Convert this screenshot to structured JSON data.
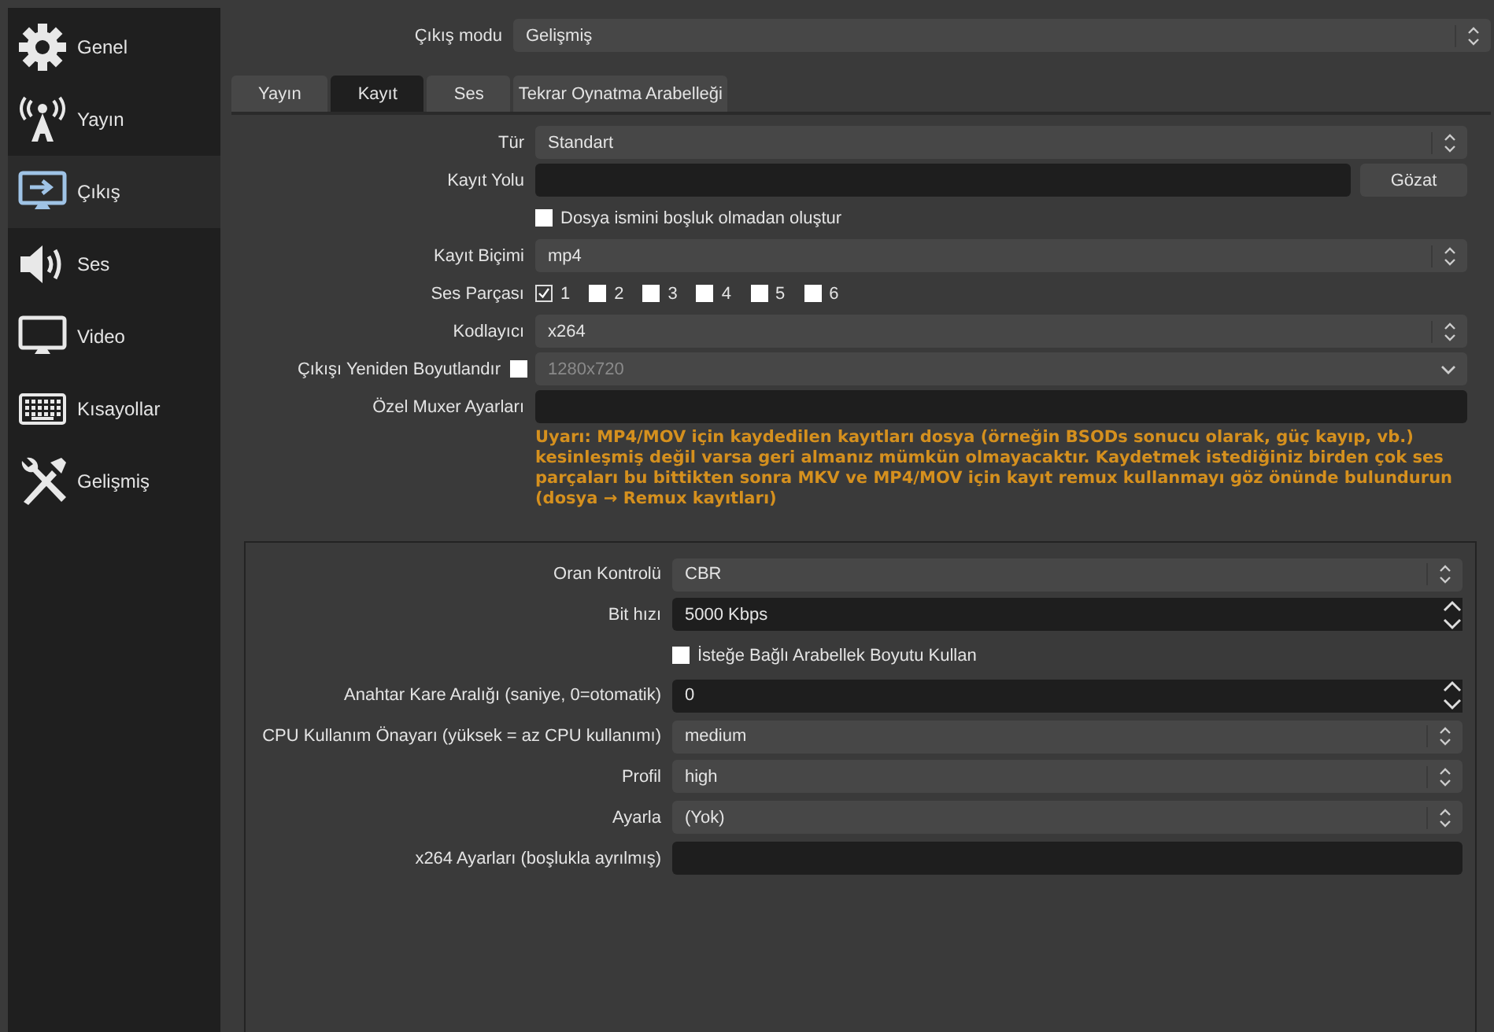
{
  "sidebar": {
    "items": [
      {
        "label": "Genel",
        "kind": "gear",
        "selected": false
      },
      {
        "label": "Yayın",
        "kind": "antenna",
        "selected": false
      },
      {
        "label": "Çıkış",
        "kind": "output",
        "selected": true
      },
      {
        "label": "Ses",
        "kind": "speaker",
        "selected": false
      },
      {
        "label": "Video",
        "kind": "monitor",
        "selected": false
      },
      {
        "label": "Kısayollar",
        "kind": "keyboard",
        "selected": false
      },
      {
        "label": "Gelişmiş",
        "kind": "tools",
        "selected": false
      }
    ]
  },
  "output_mode": {
    "label": "Çıkış modu",
    "value": "Gelişmiş"
  },
  "tabs": [
    {
      "label": "Yayın",
      "selected": false
    },
    {
      "label": "Kayıt",
      "selected": true
    },
    {
      "label": "Ses",
      "selected": false
    },
    {
      "label": "Tekrar Oynatma Arabelleği",
      "selected": false
    }
  ],
  "recording": {
    "rows": [
      {
        "kind": "combo",
        "label": "Tür",
        "value": "Standart"
      },
      {
        "kind": "path",
        "label": "Kayıt Yolu",
        "button": "Gözat"
      },
      {
        "kind": "checkbox",
        "label": "Dosya ismini boşluk olmadan oluştur",
        "checked": false
      },
      {
        "kind": "combo",
        "label": "Kayıt Biçimi",
        "value": "mp4"
      },
      {
        "kind": "tracks",
        "label": "Ses Parçası",
        "tracks": [
          {
            "label": "1",
            "checked": true
          },
          {
            "label": "2",
            "checked": false
          },
          {
            "label": "3",
            "checked": false
          },
          {
            "label": "4",
            "checked": false
          },
          {
            "label": "5",
            "checked": false
          },
          {
            "label": "6",
            "checked": false
          }
        ]
      },
      {
        "kind": "combo",
        "label": "Kodlayıcı",
        "value": "x264"
      },
      {
        "kind": "rescale",
        "label": "Çıkışı Yeniden Boyutlandır",
        "checked": false,
        "value": "1280x720",
        "disabled": true
      },
      {
        "kind": "text",
        "label": "Özel Muxer Ayarları"
      },
      {
        "kind": "warning",
        "text": "Uyarı: MP4/MOV için kaydedilen kayıtları dosya (örneğin BSODs sonucu olarak, güç kayıp, vb.) kesinleşmiş değil varsa geri almanız mümkün olmayacaktır. Kaydetmek istediğiniz birden çok ses parçaları bu bittikten sonra MKV ve MP4/MOV için kayıt remux kullanmayı göz önünde bulundurun (dosya → Remux kayıtları)"
      }
    ]
  },
  "encoder": {
    "rows": [
      {
        "kind": "combo",
        "label": "Oran Kontrolü",
        "value": "CBR"
      },
      {
        "kind": "spin",
        "label": "Bit hızı",
        "value": "5000 Kbps"
      },
      {
        "kind": "checkbox",
        "label": "İsteğe Bağlı Arabellek Boyutu Kullan",
        "checked": false
      },
      {
        "kind": "spin",
        "label": "Anahtar Kare Aralığı (saniye, 0=otomatik)",
        "value": "0"
      },
      {
        "kind": "combo",
        "label": "CPU Kullanım Önayarı (yüksek = az CPU kullanımı)",
        "value": "medium"
      },
      {
        "kind": "combo",
        "label": "Profil",
        "value": "high"
      },
      {
        "kind": "combo",
        "label": "Ayarla",
        "value": "(Yok)"
      },
      {
        "kind": "text",
        "label": "x264 Ayarları (boşlukla ayrılmış)"
      }
    ]
  }
}
